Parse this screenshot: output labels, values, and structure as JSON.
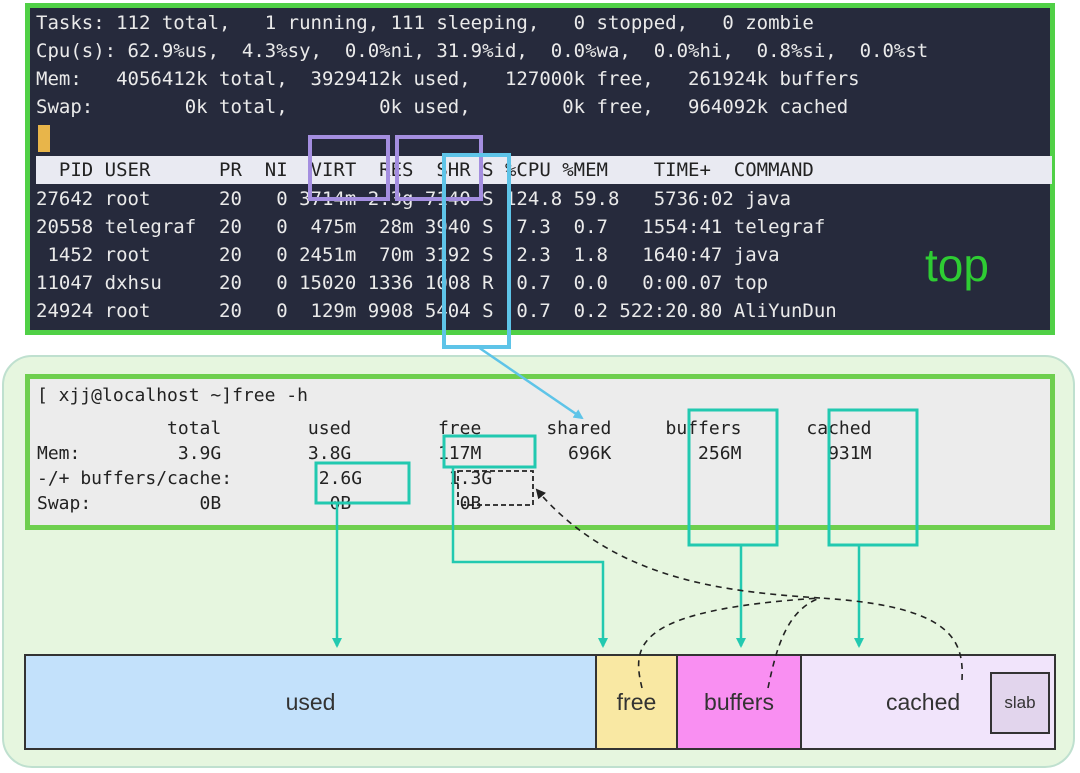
{
  "top": {
    "summary": [
      "Tasks: 112 total,   1 running, 111 sleeping,   0 stopped,   0 zombie",
      "Cpu(s): 62.9%us,  4.3%sy,  0.0%ni, 31.9%id,  0.0%wa,  0.0%hi,  0.8%si,  0.0%st",
      "Mem:   4056412k total,  3929412k used,   127000k free,   261924k buffers",
      "Swap:        0k total,        0k used,        0k free,   964092k cached"
    ],
    "header": "  PID USER      PR  NI  VIRT  RES  SHR S %CPU %MEM    TIME+  COMMAND",
    "rows": [
      "27642 root      20   0 3714m 2.3g 7140 S 124.8 59.8   5736:02 java",
      "20558 telegraf  20   0  475m  28m 3940 S  7.3  0.7   1554:41 telegraf",
      " 1452 root      20   0 2451m  70m 3192 S  2.3  1.8   1640:47 java",
      "11047 dxhsu     20   0 15020 1336 1008 R  0.7  0.0   0:00.07 top",
      "24924 root      20   0  129m 9908 5404 S  0.7  0.2 522:20.80 AliYunDun"
    ],
    "label": "top"
  },
  "free": {
    "prompt": "[ xjj@localhost ~]free -h",
    "header": "            total        used        free      shared     buffers      cached",
    "rows": [
      "Mem:         3.9G        3.8G        117M        696K        256M        931M",
      "-/+ buffers/cache:        2.6G        1.3G",
      "Swap:          0B          0B          0B"
    ]
  },
  "memory_bar": {
    "used": "used",
    "free": "free",
    "buffers": "buffers",
    "cached": "cached",
    "slab": "slab"
  },
  "colors": {
    "top_border": "#50d046",
    "highlight_purple": "#a48ee0",
    "highlight_cyan": "#5ec4e8",
    "highlight_teal": "#22c9b0",
    "used": "#c3e1fb",
    "free": "#f9e8a3",
    "buffers": "#f98ff2",
    "cached": "#f1e4fb"
  }
}
